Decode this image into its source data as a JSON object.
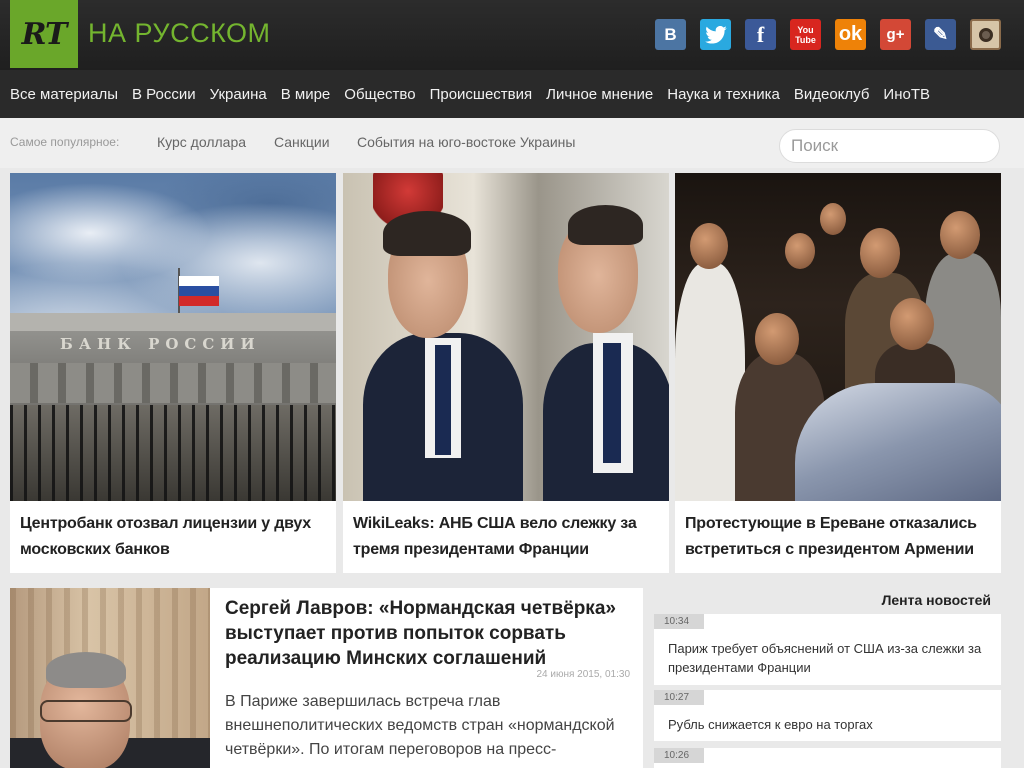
{
  "header": {
    "logo_text": "RT",
    "logo_sub": "НА РУССКОМ",
    "social": {
      "vk": "В",
      "twitter": "t",
      "facebook": "f",
      "youtube_top": "You",
      "youtube_bottom": "Tube",
      "ok": "ok",
      "gplus": "g+",
      "lj": "✎"
    }
  },
  "nav": {
    "items": [
      "Все материалы",
      "В России",
      "Украина",
      "В мире",
      "Общество",
      "Происшествия",
      "Личное мнение",
      "Наука и техника",
      "Видеоклуб",
      "ИноТВ"
    ]
  },
  "popular": {
    "label": "Самое популярное:",
    "links": [
      "Курс доллара",
      "Санкции",
      "События на юго-востоке Украины"
    ],
    "search_placeholder": "Поиск"
  },
  "cards": [
    {
      "title": "Центробанк отозвал лицензии у двух московских банков",
      "image": "bank-of-russia-building",
      "sign": "БАНК РОССИИ"
    },
    {
      "title": "WikiLeaks: АНБ США вело слежку за тремя президентами Франции",
      "image": "french-presidents"
    },
    {
      "title": "Протестующие в Ереване отказались встретиться с президентом Армении",
      "image": "yerevan-protest"
    }
  ],
  "lead": {
    "title": "Сергей Лавров: «Нормандская четвёрка» выступает против попыток сорвать реализацию Минских соглашений",
    "date": "24 июня 2015, 01:30",
    "text": "В Париже завершилась встреча глав внешнеполитических ведомств стран «нормандской четвёрки». По итогам переговоров на пресс-"
  },
  "feed": {
    "title": "Лента новостей",
    "items": [
      {
        "time": "10:34",
        "text": "Париж требует объяснений от США из-за слежки за президентами Франции"
      },
      {
        "time": "10:27",
        "text": "Рубль снижается к евро на торгах"
      },
      {
        "time": "10:26",
        "text": ""
      }
    ]
  },
  "colors": {
    "brand_green": "#6aa72a",
    "header_bg": "#2c2c2c",
    "nav_bg": "#2a2a2a"
  }
}
